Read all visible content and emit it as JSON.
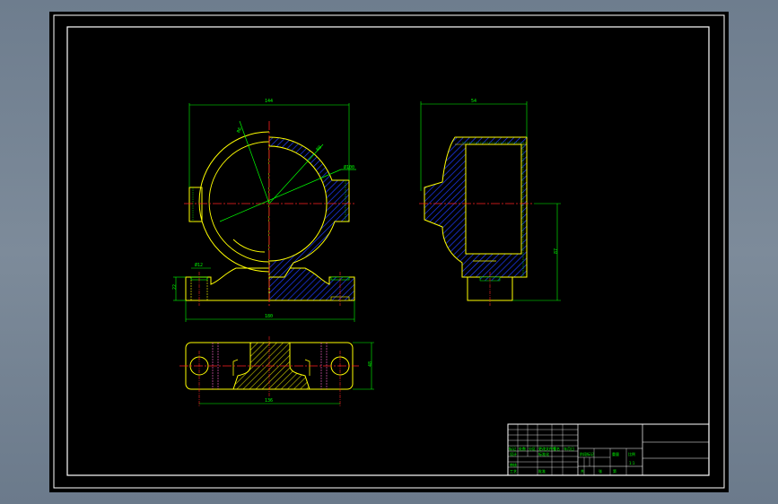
{
  "colors": {
    "background": "#000000",
    "part_outline": "#ffff00",
    "dimension": "#00ff00",
    "centerline": "#ff0000",
    "hatch": "#0000ff",
    "border": "#ffffff"
  },
  "dimensions": {
    "front_width": "144",
    "radius_label_1": "R6",
    "radius_label_2": "R8",
    "diameter": "Ø100",
    "bolt_hole": "Ø12",
    "foot_height": "22",
    "base_length": "180",
    "side_width": "54",
    "side_height": "87",
    "hole_spacing": "136",
    "plan_depth": "48"
  },
  "title_block": {
    "label_a": "标记",
    "label_b": "处数",
    "label_c": "分区",
    "label_d": "更改文件号",
    "label_e": "签名",
    "label_f": "年月日",
    "label_g": "设计",
    "label_h": "标准化",
    "label_i": "阶段标记",
    "label_j": "重量",
    "label_k": "比例",
    "label_l": "审核",
    "label_m": "工艺",
    "label_n": "批准",
    "label_o": "共",
    "label_p": "张",
    "label_q": "第",
    "label_r": "1:1"
  }
}
